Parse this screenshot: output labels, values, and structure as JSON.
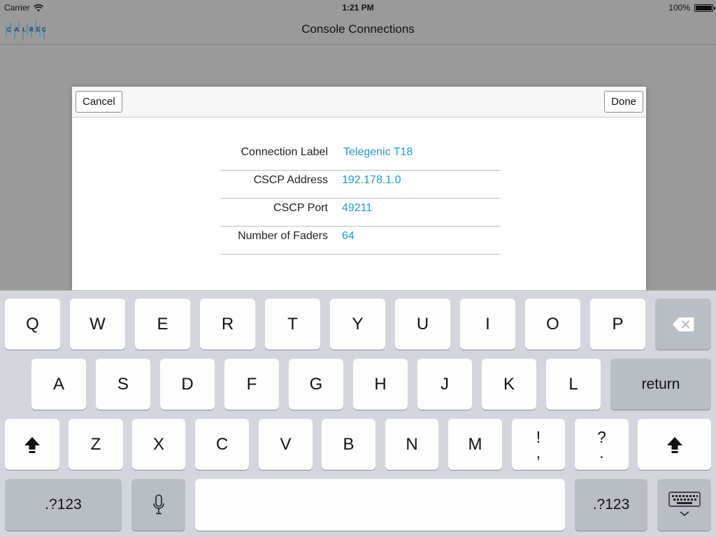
{
  "status_bar": {
    "carrier": "Carrier",
    "time": "1:21 PM",
    "battery": "100%"
  },
  "nav": {
    "title": "Console Connections",
    "logo_text": "CALREC"
  },
  "modal": {
    "cancel_label": "Cancel",
    "done_label": "Done",
    "fields": [
      {
        "label": "Connection Label",
        "value": "Telegenic T18"
      },
      {
        "label": "CSCP Address",
        "value": "192.178.1.0"
      },
      {
        "label": "CSCP Port",
        "value": "49211"
      },
      {
        "label": "Number of Faders",
        "value": "64"
      }
    ]
  },
  "keyboard": {
    "row1": [
      "Q",
      "W",
      "E",
      "R",
      "T",
      "Y",
      "U",
      "I",
      "O",
      "P"
    ],
    "row2": [
      "A",
      "S",
      "D",
      "F",
      "G",
      "H",
      "J",
      "K",
      "L"
    ],
    "row3": [
      "Z",
      "X",
      "C",
      "V",
      "B",
      "N",
      "M"
    ],
    "punct1": {
      "top": "!",
      "bottom": ","
    },
    "punct2": {
      "top": "?",
      "bottom": "."
    },
    "return_label": "return",
    "numbers_label": ".?123",
    "icons": {
      "delete": "backspace-icon",
      "shift": "shift-icon",
      "mic": "microphone-icon",
      "hide": "keyboard-hide-icon"
    }
  },
  "colors": {
    "accent": "#1f9ad1",
    "keyboard_bg": "#d3d6dc",
    "dim_bg": "#9a9a9a"
  }
}
